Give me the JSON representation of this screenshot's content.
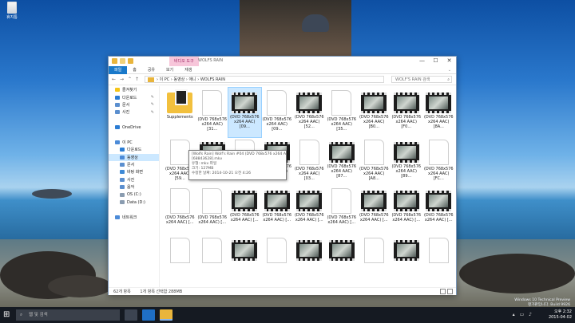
{
  "desktop": {
    "icon_label": "휴지통",
    "watermark_line1": "Windows 10 Technical Preview",
    "watermark_line2": "평가판입니다. Build 9926"
  },
  "window": {
    "context_tab": "비디오 도구",
    "title_blurred": "WOLFS RAIN",
    "controls": [
      "—",
      "☐",
      "✕"
    ],
    "ribbon_tabs": [
      "파일",
      "홈",
      "공유",
      "보기",
      "재생"
    ],
    "ribbon_caret": "⌄",
    "nav_buttons": [
      "←",
      "→",
      "⌃",
      "↑"
    ],
    "breadcrumb": "› 이 PC › 동영상 › 애니 › WOLFS RAIN",
    "search_placeholder": "WOLF'S RAIN 검색",
    "search_icon": "⌕"
  },
  "nav": {
    "items": [
      {
        "label": "즐겨찾기",
        "icon": "star-icon",
        "color": "#f5c518",
        "pin": false
      },
      {
        "label": "다운로드",
        "icon": "download-icon",
        "color": "#2b7cd3",
        "pin": true
      },
      {
        "label": "문서",
        "icon": "documents-icon",
        "color": "#5b8fcf",
        "pin": true
      },
      {
        "label": "사진",
        "icon": "pictures-icon",
        "color": "#5b8fcf",
        "pin": true
      },
      {
        "label": "",
        "icon": "",
        "color": "",
        "pin": false
      },
      {
        "label": "OneDrive",
        "icon": "cloud-icon",
        "color": "#2b7cd3",
        "pin": false
      },
      {
        "label": "",
        "icon": "",
        "color": "",
        "pin": false
      },
      {
        "label": "이 PC",
        "icon": "computer-icon",
        "color": "#4c8bd8",
        "pin": false
      },
      {
        "label": "다운로드",
        "icon": "download-icon",
        "color": "#2b7cd3",
        "pin": false
      },
      {
        "label": "동영상",
        "icon": "videos-icon",
        "color": "#4c8bd8",
        "pin": false,
        "selected": true
      },
      {
        "label": "문서",
        "icon": "documents-icon",
        "color": "#5b8fcf",
        "pin": false
      },
      {
        "label": "바탕 화면",
        "icon": "desktop-icon",
        "color": "#3f8ad6",
        "pin": false
      },
      {
        "label": "사진",
        "icon": "pictures-icon",
        "color": "#5b8fcf",
        "pin": false
      },
      {
        "label": "음악",
        "icon": "music-icon",
        "color": "#5b8fcf",
        "pin": false
      },
      {
        "label": "OS (C:)",
        "icon": "drive-icon",
        "color": "#8a9cb0",
        "pin": false
      },
      {
        "label": "Data (D:)",
        "icon": "drive-icon",
        "color": "#8a9cb0",
        "pin": false
      },
      {
        "label": "",
        "icon": "",
        "color": "",
        "pin": false
      },
      {
        "label": "네트워크",
        "icon": "network-icon",
        "color": "#4c8bd8",
        "pin": false
      }
    ]
  },
  "files": [
    {
      "type": "folder",
      "name": "Supplements"
    },
    {
      "type": "doc",
      "name": "(DVD 768x576\nx264 AAC) [31..."
    },
    {
      "type": "film",
      "name": "(DVD 768x576\nx264 AAC) [09..."
    },
    {
      "type": "doc",
      "name": "(DVD 768x576\nx264 AAC) [09..."
    },
    {
      "type": "film",
      "name": "(DVD 768x576\nx264 AAC) [52..."
    },
    {
      "type": "doc",
      "name": "(DVD 768x576\nx264 AAC) [35..."
    },
    {
      "type": "film",
      "name": "(DVD 768x576\nx264 AAC) [B0..."
    },
    {
      "type": "film",
      "name": "(DVD 768x576\nx264 AAC) [F0..."
    },
    {
      "type": "film",
      "name": "(DVD 768x576\nx264 AAC) [8A..."
    },
    {
      "type": "doc",
      "name": "(DVD 768x576\nx264 AAC) [59..."
    },
    {
      "type": "film",
      "name": "(DVD 768x576\nx264 AAC) [FE..."
    },
    {
      "type": "doc",
      "name": "(DVD 768x576\nx264 AAC) [08..."
    },
    {
      "type": "film",
      "name": "(DVD 768x576\nx264 AAC) [9B..."
    },
    {
      "type": "doc",
      "name": "(DVD 768x576\nx264 AAC) [03..."
    },
    {
      "type": "film",
      "name": "(DVD 768x576\nx264 AAC) [87..."
    },
    {
      "type": "doc",
      "name": "(DVD 768x576\nx264 AAC) [A8..."
    },
    {
      "type": "film",
      "name": "(DVD 768x576\nx264 AAC) [89..."
    },
    {
      "type": "doc",
      "name": "(DVD 768x576\nx264 AAC) [FC..."
    },
    {
      "type": "doc",
      "name": "(DVD 768x576\nx264 AAC) [..."
    },
    {
      "type": "doc",
      "name": "(DVD 768x576\nx264 AAC) [..."
    },
    {
      "type": "film",
      "name": "(DVD 768x576\nx264 AAC) [..."
    },
    {
      "type": "film",
      "name": "(DVD 768x576\nx264 AAC) [..."
    },
    {
      "type": "film",
      "name": "(DVD 768x576\nx264 AAC) [..."
    },
    {
      "type": "doc",
      "name": "(DVD 768x576\nx264 AAC) [..."
    },
    {
      "type": "film",
      "name": "(DVD 768x576\nx264 AAC) [..."
    },
    {
      "type": "film",
      "name": "(DVD 768x576\nx264 AAC) [..."
    },
    {
      "type": "film",
      "name": "(DVD 768x576\nx264 AAC) [..."
    },
    {
      "type": "doc",
      "name": ""
    },
    {
      "type": "doc",
      "name": ""
    },
    {
      "type": "film",
      "name": ""
    },
    {
      "type": "doc",
      "name": ""
    },
    {
      "type": "film",
      "name": ""
    },
    {
      "type": "film",
      "name": ""
    },
    {
      "type": "doc",
      "name": ""
    },
    {
      "type": "film",
      "name": ""
    },
    {
      "type": "doc",
      "name": ""
    }
  ],
  "tooltip": {
    "lines": [
      "[Wolfs Rain] Wolf's Rain #04 (DVD 768x576 x264 AAC)",
      "[68843628].mkv",
      "유형: mkv 파일",
      "크기: 127MB",
      "수정한 날짜: 2014-10-21 오전 4:26"
    ]
  },
  "status": {
    "count": "62개 항목",
    "selection": "1개 항목 선택함 288MB"
  },
  "taskbar": {
    "start_icon": "⊞",
    "search_placeholder": "웹 및 검색",
    "search_icon": "⌕",
    "tray_icons": "▴ ▭ ♪",
    "time": "오후 2:32",
    "date": "2015-04-02"
  }
}
